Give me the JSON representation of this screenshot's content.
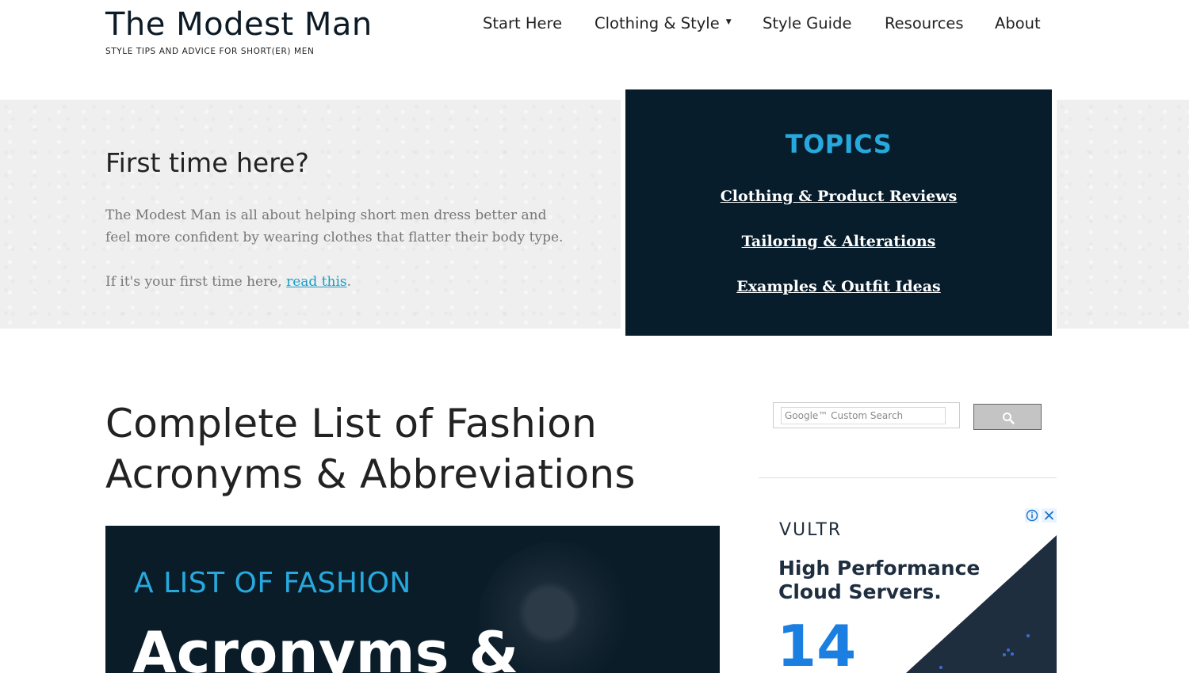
{
  "header": {
    "site_title": "The Modest Man",
    "tagline": "STYLE TIPS AND ADVICE FOR SHORT(ER) MEN",
    "nav": [
      {
        "label": "Start Here"
      },
      {
        "label": "Clothing & Style",
        "has_dropdown": true
      },
      {
        "label": "Style Guide"
      },
      {
        "label": "Resources"
      },
      {
        "label": "About"
      }
    ]
  },
  "hero": {
    "heading": "First time here?",
    "paragraph": "The Modest Man is all about helping short men dress better and feel more confident by wearing clothes that flatter their body type.",
    "cta_prefix": "If it's your first time here, ",
    "cta_link": "read this",
    "cta_suffix": "."
  },
  "topics": {
    "title": "TOPICS",
    "links": [
      "Clothing & Product Reviews",
      "Tailoring & Alterations",
      "Examples & Outfit Ideas"
    ]
  },
  "article": {
    "title_line1": "Complete List of Fashion",
    "title_line2": "Acronyms & Abbreviations",
    "image_kicker": "A LIST OF FASHION",
    "image_headline": "Acronyms &"
  },
  "sidebar": {
    "search_placeholder": "Google™ Custom Search",
    "search_icon": "search-icon",
    "ad": {
      "brand": "VULTR",
      "headline": "High Performance Cloud Servers.",
      "number": "14"
    }
  },
  "colors": {
    "accent": "#27a9de",
    "link": "#1a9cc7",
    "dark_navy": "#071d2b",
    "ad_blue": "#1a7fe0"
  }
}
